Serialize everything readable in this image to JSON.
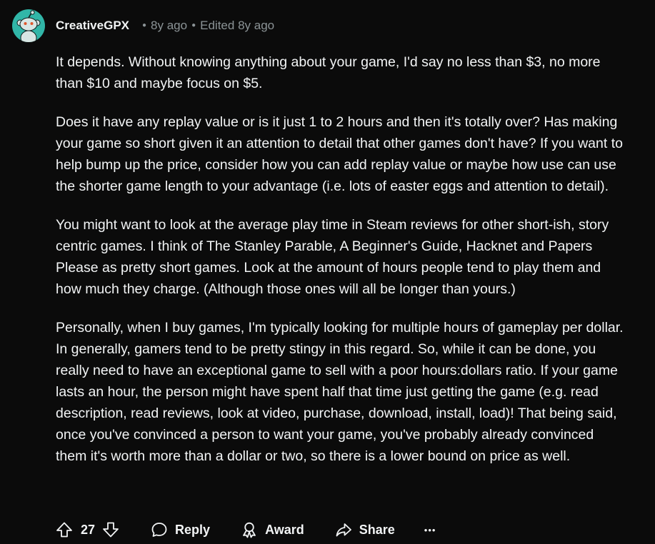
{
  "comment": {
    "author": "CreativeGPX",
    "posted": "8y ago",
    "edited": "Edited 8y ago",
    "paragraphs": [
      "It depends. Without knowing anything about your game, I'd say no less than $3, no more than $10 and maybe focus on $5.",
      "Does it have any replay value or is it just 1 to 2 hours and then it's totally over? Has making your game so short given it an attention to detail that other games don't have? If you want to help bump up the price, consider how you can add replay value or maybe how use can use the shorter game length to your advantage (i.e. lots of easter eggs and attention to detail).",
      "You might want to look at the average play time in Steam reviews for other short-ish, story centric games. I think of The Stanley Parable, A Beginner's Guide, Hacknet and Papers Please as pretty short games. Look at the amount of hours people tend to play them and how much they charge. (Although those ones will all be longer than yours.)",
      "Personally, when I buy games, I'm typically looking for multiple hours of gameplay per dollar. In generally, gamers tend to be pretty stingy in this regard. So, while it can be done, you really need to have an exceptional game to sell with a poor hours:dollars ratio. If your game lasts an hour, the person might have spent half that time just getting the game (e.g. read description, read reviews, look at video, purchase, download, install, load)! That being said, once you've convinced a person to want your game, you've probably already convinced them it's worth more than a dollar or two, so there is a lower bound on price as well."
    ]
  },
  "actions": {
    "score": "27",
    "reply_label": "Reply",
    "award_label": "Award",
    "share_label": "Share",
    "more_label": "•••"
  },
  "icons": {
    "avatar": "snoo-avatar-icon",
    "upvote": "upvote-arrow-icon",
    "downvote": "downvote-arrow-icon",
    "reply": "speech-bubble-icon",
    "award": "award-ribbon-icon",
    "share": "share-arrow-icon"
  },
  "colors": {
    "background": "#0b0b0b",
    "text": "#f2f4f5",
    "meta": "#8b9396",
    "avatar_bg": "#31b6a8"
  }
}
